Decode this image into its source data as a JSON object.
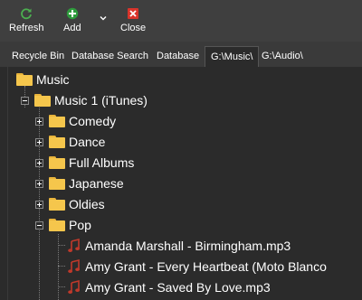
{
  "toolbar": {
    "refresh_label": "Refresh",
    "add_label": "Add",
    "close_label": "Close",
    "colors": {
      "refresh": "#4caf50",
      "add": "#2e9b3c",
      "close": "#d9342b"
    }
  },
  "tabs": [
    {
      "label": "Recycle Bin"
    },
    {
      "label": "Database Search"
    },
    {
      "label": "Database"
    },
    {
      "label": "G:\\Music\\",
      "active": true
    },
    {
      "label": "G:\\Audio\\"
    }
  ],
  "tree": {
    "root": {
      "label": "Music",
      "icon": "folder-icon"
    },
    "library": {
      "label": "Music 1 (iTunes)",
      "expanded": true,
      "icon": "folder-icon"
    },
    "folders": [
      {
        "label": "Comedy",
        "expanded": false
      },
      {
        "label": "Dance",
        "expanded": false
      },
      {
        "label": "Full Albums",
        "expanded": false
      },
      {
        "label": "Japanese",
        "expanded": false
      },
      {
        "label": "Oldies",
        "expanded": false
      },
      {
        "label": "Pop",
        "expanded": true
      }
    ],
    "files": [
      {
        "label": "Amanda Marshall - Birmingham.mp3",
        "icon": "music-note-icon"
      },
      {
        "label": "Amy Grant - Every Heartbeat (Moto Blanco",
        "icon": "music-note-icon"
      },
      {
        "label": "Amy Grant - Saved By Love.mp3",
        "icon": "music-note-icon"
      }
    ],
    "colors": {
      "folder": "#f5c64c",
      "note": "#c0392b"
    }
  }
}
